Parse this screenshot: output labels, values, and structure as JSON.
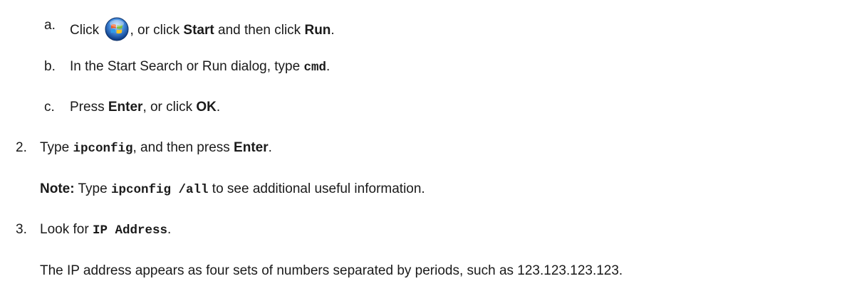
{
  "steps": {
    "a": {
      "marker": "a.",
      "t1": "Click",
      "t2": ", or click",
      "b1": "Start",
      "t3": "and then click",
      "b2": "Run",
      "t4": ".",
      "icon": "windows-start-orb-icon"
    },
    "b": {
      "marker": "b.",
      "t1": "In the Start Search or Run dialog, type",
      "code": "cmd",
      "t2": "."
    },
    "c": {
      "marker": "c.",
      "t1": "Press",
      "b1": "Enter",
      "t2": ", or click",
      "b2": "OK",
      "t3": "."
    },
    "s2": {
      "marker": "2.",
      "t1": "Type",
      "code": "ipconfig",
      "t2": ", and then press",
      "b1": "Enter",
      "t3": "."
    },
    "note": {
      "label": "Note:",
      "t1": "Type",
      "code": "ipconfig /all",
      "t2": "to see additional useful information."
    },
    "s3": {
      "marker": "3.",
      "t1": "Look for",
      "code": "IP Address",
      "t2": "."
    },
    "s3_desc": "The IP address appears as four sets of numbers separated by periods, such as 123.123.123.123."
  }
}
